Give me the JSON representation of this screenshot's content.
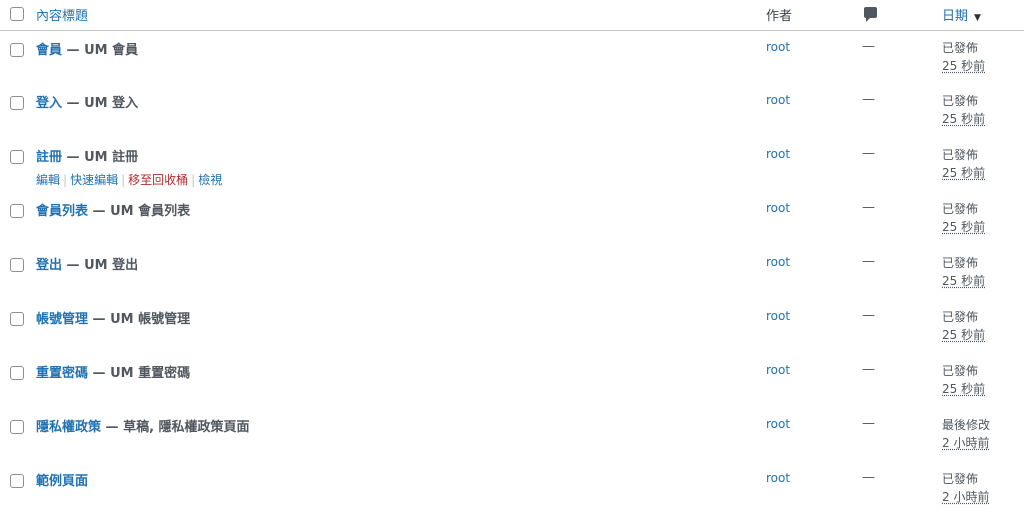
{
  "header": {
    "title": "內容標題",
    "author": "作者",
    "comments_icon": "comment-bubble-icon",
    "date": "日期",
    "sort_icon": "▼"
  },
  "row_actions": {
    "edit": "編輯",
    "quick_edit": "快速編輯",
    "trash": "移至回收桶",
    "view": "檢視"
  },
  "rows": [
    {
      "title": "會員",
      "state": " — UM 會員",
      "author": "root",
      "comments": "—",
      "status": "已發佈",
      "time": "25 秒前"
    },
    {
      "title": "登入",
      "state": " — UM 登入",
      "author": "root",
      "comments": "—",
      "status": "已發佈",
      "time": "25 秒前"
    },
    {
      "title": "註冊",
      "state": " — UM 註冊",
      "author": "root",
      "comments": "—",
      "status": "已發佈",
      "time": "25 秒前"
    },
    {
      "title": "會員列表",
      "state": " — UM 會員列表",
      "author": "root",
      "comments": "—",
      "status": "已發佈",
      "time": "25 秒前"
    },
    {
      "title": "登出",
      "state": " — UM 登出",
      "author": "root",
      "comments": "—",
      "status": "已發佈",
      "time": "25 秒前"
    },
    {
      "title": "帳號管理",
      "state": " — UM 帳號管理",
      "author": "root",
      "comments": "—",
      "status": "已發佈",
      "time": "25 秒前"
    },
    {
      "title": "重置密碼",
      "state": " — UM 重置密碼",
      "author": "root",
      "comments": "—",
      "status": "已發佈",
      "time": "25 秒前"
    },
    {
      "title": "隱私權政策",
      "state": " — 草稿, 隱私權政策頁面",
      "author": "root",
      "comments": "—",
      "status": "最後修改",
      "time": "2 小時前"
    },
    {
      "title": "範例頁面",
      "state": "",
      "author": "root",
      "comments": "—",
      "status": "已發佈",
      "time": "2 小時前"
    }
  ],
  "colors": {
    "link": "#2271b1",
    "trash": "#b32d2e",
    "text": "#3c434a"
  }
}
